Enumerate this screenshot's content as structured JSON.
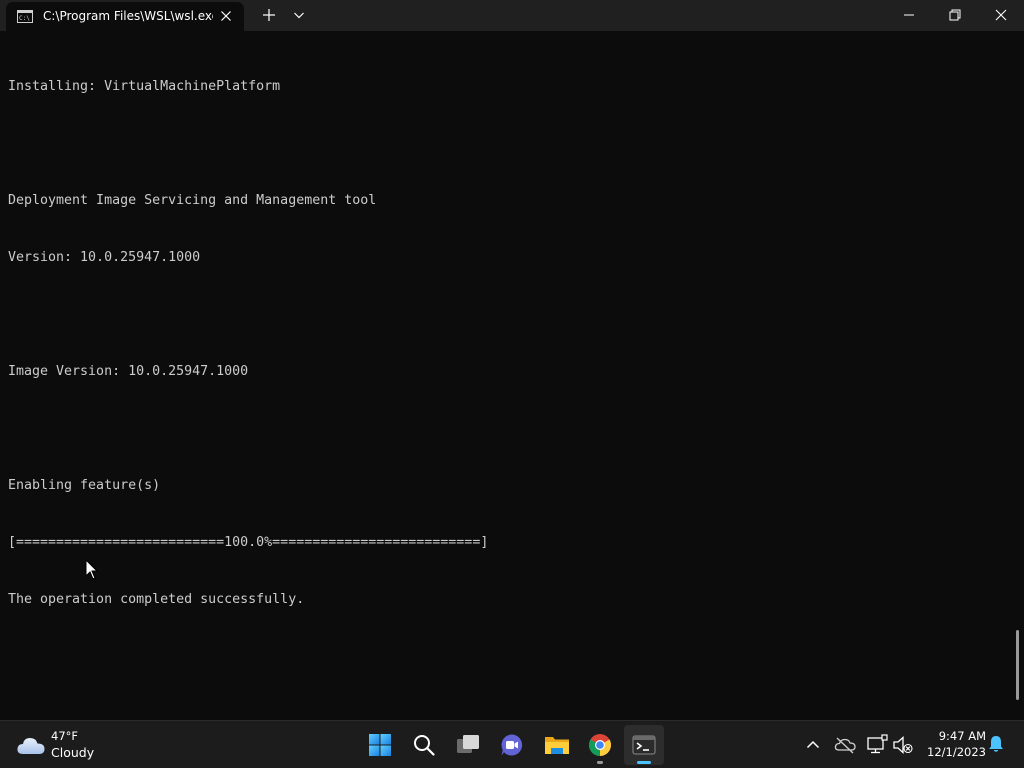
{
  "window": {
    "tab_title": "C:\\Program Files\\WSL\\wsl.exe",
    "icons": {
      "tab": "console-icon",
      "close_tab": "close-icon",
      "new_tab": "plus-icon",
      "dropdown": "chevron-down-icon",
      "minimize": "minimize-icon",
      "maximize": "restore-icon",
      "close": "close-icon"
    }
  },
  "terminal": {
    "lines": [
      "Installing: VirtualMachinePlatform",
      "",
      "Deployment Image Servicing and Management tool",
      "Version: 10.0.25947.1000",
      "",
      "Image Version: 10.0.25947.1000",
      "",
      "Enabling feature(s)",
      "[==========================100.0%==========================]",
      "The operation completed successfully."
    ],
    "foreground": "#cccccc",
    "background": "#0c0c0c"
  },
  "taskbar": {
    "weather": {
      "temp": "47°F",
      "condition": "Cloudy",
      "icon": "cloud-icon"
    },
    "apps": [
      {
        "name": "start",
        "icon": "windows-start-icon"
      },
      {
        "name": "search",
        "icon": "search-icon"
      },
      {
        "name": "task-view",
        "icon": "task-view-icon"
      },
      {
        "name": "chat",
        "icon": "teams-chat-icon"
      },
      {
        "name": "file-explorer",
        "icon": "folder-icon"
      },
      {
        "name": "chrome",
        "icon": "chrome-icon"
      },
      {
        "name": "terminal",
        "icon": "terminal-icon",
        "active": true
      }
    ],
    "tray": {
      "icons": [
        "chevron-up-icon",
        "onedrive-icon",
        "network-icon",
        "volume-muted-icon"
      ]
    },
    "clock": {
      "time": "9:47 AM",
      "date": "12/1/2023"
    },
    "notifications_icon": "bell-icon",
    "accent_color": "#4cc2ff"
  }
}
